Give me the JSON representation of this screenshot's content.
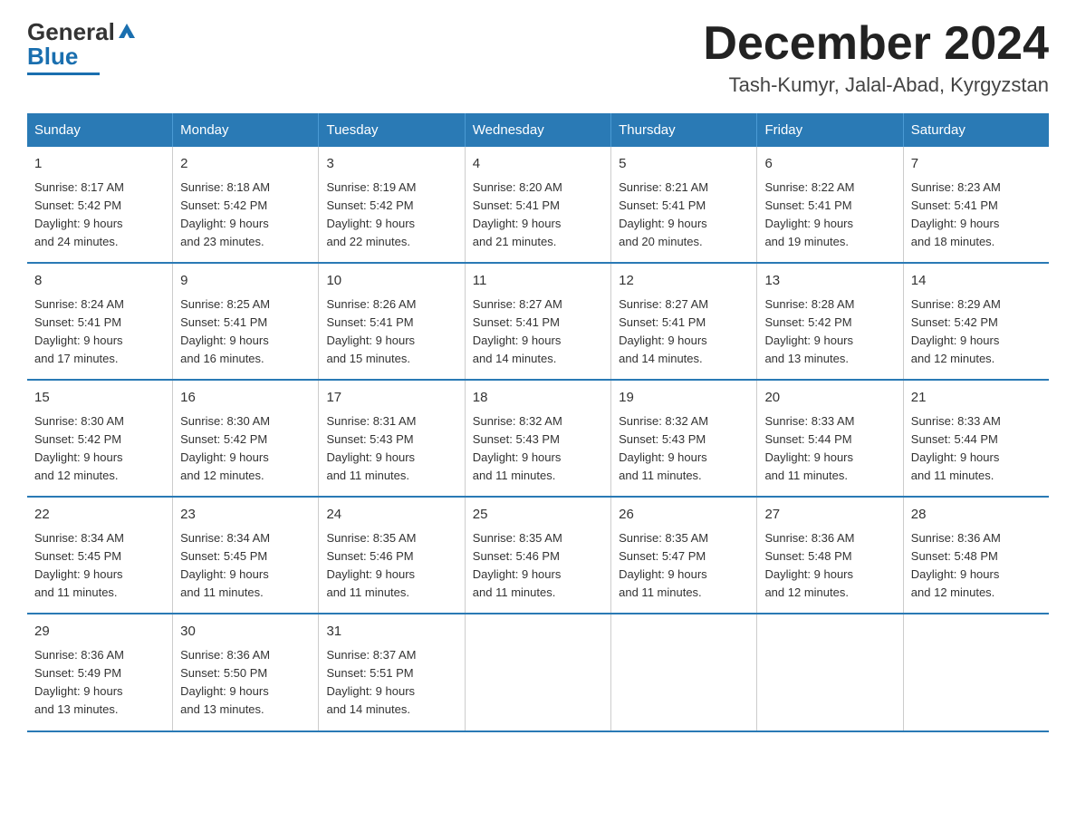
{
  "header": {
    "title": "December 2024",
    "subtitle": "Tash-Kumyr, Jalal-Abad, Kyrgyzstan"
  },
  "columns": [
    "Sunday",
    "Monday",
    "Tuesday",
    "Wednesday",
    "Thursday",
    "Friday",
    "Saturday"
  ],
  "weeks": [
    [
      {
        "day": "1",
        "info": "Sunrise: 8:17 AM\nSunset: 5:42 PM\nDaylight: 9 hours\nand 24 minutes."
      },
      {
        "day": "2",
        "info": "Sunrise: 8:18 AM\nSunset: 5:42 PM\nDaylight: 9 hours\nand 23 minutes."
      },
      {
        "day": "3",
        "info": "Sunrise: 8:19 AM\nSunset: 5:42 PM\nDaylight: 9 hours\nand 22 minutes."
      },
      {
        "day": "4",
        "info": "Sunrise: 8:20 AM\nSunset: 5:41 PM\nDaylight: 9 hours\nand 21 minutes."
      },
      {
        "day": "5",
        "info": "Sunrise: 8:21 AM\nSunset: 5:41 PM\nDaylight: 9 hours\nand 20 minutes."
      },
      {
        "day": "6",
        "info": "Sunrise: 8:22 AM\nSunset: 5:41 PM\nDaylight: 9 hours\nand 19 minutes."
      },
      {
        "day": "7",
        "info": "Sunrise: 8:23 AM\nSunset: 5:41 PM\nDaylight: 9 hours\nand 18 minutes."
      }
    ],
    [
      {
        "day": "8",
        "info": "Sunrise: 8:24 AM\nSunset: 5:41 PM\nDaylight: 9 hours\nand 17 minutes."
      },
      {
        "day": "9",
        "info": "Sunrise: 8:25 AM\nSunset: 5:41 PM\nDaylight: 9 hours\nand 16 minutes."
      },
      {
        "day": "10",
        "info": "Sunrise: 8:26 AM\nSunset: 5:41 PM\nDaylight: 9 hours\nand 15 minutes."
      },
      {
        "day": "11",
        "info": "Sunrise: 8:27 AM\nSunset: 5:41 PM\nDaylight: 9 hours\nand 14 minutes."
      },
      {
        "day": "12",
        "info": "Sunrise: 8:27 AM\nSunset: 5:41 PM\nDaylight: 9 hours\nand 14 minutes."
      },
      {
        "day": "13",
        "info": "Sunrise: 8:28 AM\nSunset: 5:42 PM\nDaylight: 9 hours\nand 13 minutes."
      },
      {
        "day": "14",
        "info": "Sunrise: 8:29 AM\nSunset: 5:42 PM\nDaylight: 9 hours\nand 12 minutes."
      }
    ],
    [
      {
        "day": "15",
        "info": "Sunrise: 8:30 AM\nSunset: 5:42 PM\nDaylight: 9 hours\nand 12 minutes."
      },
      {
        "day": "16",
        "info": "Sunrise: 8:30 AM\nSunset: 5:42 PM\nDaylight: 9 hours\nand 12 minutes."
      },
      {
        "day": "17",
        "info": "Sunrise: 8:31 AM\nSunset: 5:43 PM\nDaylight: 9 hours\nand 11 minutes."
      },
      {
        "day": "18",
        "info": "Sunrise: 8:32 AM\nSunset: 5:43 PM\nDaylight: 9 hours\nand 11 minutes."
      },
      {
        "day": "19",
        "info": "Sunrise: 8:32 AM\nSunset: 5:43 PM\nDaylight: 9 hours\nand 11 minutes."
      },
      {
        "day": "20",
        "info": "Sunrise: 8:33 AM\nSunset: 5:44 PM\nDaylight: 9 hours\nand 11 minutes."
      },
      {
        "day": "21",
        "info": "Sunrise: 8:33 AM\nSunset: 5:44 PM\nDaylight: 9 hours\nand 11 minutes."
      }
    ],
    [
      {
        "day": "22",
        "info": "Sunrise: 8:34 AM\nSunset: 5:45 PM\nDaylight: 9 hours\nand 11 minutes."
      },
      {
        "day": "23",
        "info": "Sunrise: 8:34 AM\nSunset: 5:45 PM\nDaylight: 9 hours\nand 11 minutes."
      },
      {
        "day": "24",
        "info": "Sunrise: 8:35 AM\nSunset: 5:46 PM\nDaylight: 9 hours\nand 11 minutes."
      },
      {
        "day": "25",
        "info": "Sunrise: 8:35 AM\nSunset: 5:46 PM\nDaylight: 9 hours\nand 11 minutes."
      },
      {
        "day": "26",
        "info": "Sunrise: 8:35 AM\nSunset: 5:47 PM\nDaylight: 9 hours\nand 11 minutes."
      },
      {
        "day": "27",
        "info": "Sunrise: 8:36 AM\nSunset: 5:48 PM\nDaylight: 9 hours\nand 12 minutes."
      },
      {
        "day": "28",
        "info": "Sunrise: 8:36 AM\nSunset: 5:48 PM\nDaylight: 9 hours\nand 12 minutes."
      }
    ],
    [
      {
        "day": "29",
        "info": "Sunrise: 8:36 AM\nSunset: 5:49 PM\nDaylight: 9 hours\nand 13 minutes."
      },
      {
        "day": "30",
        "info": "Sunrise: 8:36 AM\nSunset: 5:50 PM\nDaylight: 9 hours\nand 13 minutes."
      },
      {
        "day": "31",
        "info": "Sunrise: 8:37 AM\nSunset: 5:51 PM\nDaylight: 9 hours\nand 14 minutes."
      },
      {
        "day": "",
        "info": ""
      },
      {
        "day": "",
        "info": ""
      },
      {
        "day": "",
        "info": ""
      },
      {
        "day": "",
        "info": ""
      }
    ]
  ]
}
